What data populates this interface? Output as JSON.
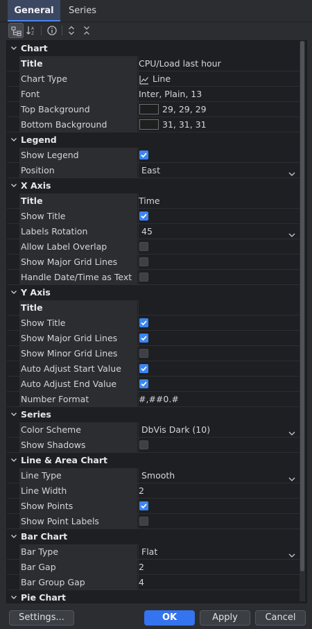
{
  "tabs": [
    "General",
    "Series"
  ],
  "sections": [
    {
      "title": "Chart",
      "rows": [
        {
          "label": "Title",
          "bold": true,
          "type": "text",
          "value": "CPU/Load last hour"
        },
        {
          "label": "Chart Type",
          "type": "charttype",
          "value": "Line",
          "icon": "line-chart-icon"
        },
        {
          "label": "Font",
          "type": "text",
          "value": "Inter, Plain, 13"
        },
        {
          "label": "Top Background",
          "type": "color",
          "value": "29, 29, 29",
          "color": "#1d1d1d"
        },
        {
          "label": "Bottom Background",
          "type": "color",
          "value": "31, 31, 31",
          "color": "#1f1f1f"
        }
      ]
    },
    {
      "title": "Legend",
      "rows": [
        {
          "label": "Show Legend",
          "type": "check",
          "checked": true
        },
        {
          "label": "Position",
          "type": "select",
          "value": "East"
        }
      ]
    },
    {
      "title": "X Axis",
      "rows": [
        {
          "label": "Title",
          "bold": true,
          "type": "text",
          "value": "Time"
        },
        {
          "label": "Show Title",
          "type": "check",
          "checked": true
        },
        {
          "label": "Labels Rotation",
          "type": "select",
          "value": "45"
        },
        {
          "label": "Allow Label Overlap",
          "type": "check",
          "checked": false
        },
        {
          "label": "Show Major Grid Lines",
          "type": "check",
          "checked": false
        },
        {
          "label": "Handle Date/Time as Text",
          "type": "check",
          "checked": false
        }
      ]
    },
    {
      "title": "Y Axis",
      "rows": [
        {
          "label": "Title",
          "bold": true,
          "type": "text",
          "value": ""
        },
        {
          "label": "Show Title",
          "type": "check",
          "checked": true
        },
        {
          "label": "Show Major Grid Lines",
          "type": "check",
          "checked": true
        },
        {
          "label": "Show Minor Grid Lines",
          "type": "check",
          "checked": false
        },
        {
          "label": "Auto Adjust Start Value",
          "type": "check",
          "checked": true
        },
        {
          "label": "Auto Adjust End Value",
          "type": "check",
          "checked": true
        },
        {
          "label": "Number Format",
          "type": "text",
          "value": "#,##0.#"
        }
      ]
    },
    {
      "title": "Series",
      "rows": [
        {
          "label": "Color Scheme",
          "type": "select",
          "value": "DbVis Dark (10)"
        },
        {
          "label": "Show Shadows",
          "type": "check",
          "checked": false
        }
      ]
    },
    {
      "title": "Line & Area Chart",
      "rows": [
        {
          "label": "Line Type",
          "type": "select",
          "value": "Smooth"
        },
        {
          "label": "Line Width",
          "type": "text",
          "value": "2"
        },
        {
          "label": "Show Points",
          "type": "check",
          "checked": true
        },
        {
          "label": "Show Point Labels",
          "type": "check",
          "checked": false
        }
      ]
    },
    {
      "title": "Bar Chart",
      "rows": [
        {
          "label": "Bar Type",
          "type": "select",
          "value": "Flat"
        },
        {
          "label": "Bar Gap",
          "type": "text",
          "value": "2"
        },
        {
          "label": "Bar Group Gap",
          "type": "text",
          "value": "4"
        }
      ]
    },
    {
      "title": "Pie Chart",
      "rows": []
    }
  ],
  "buttons": {
    "settings": "Settings...",
    "ok": "OK",
    "apply": "Apply",
    "cancel": "Cancel"
  },
  "colors": {
    "accent": "#3574f0",
    "checkbox_on": "#3d85f0",
    "tab_active_bg": "#3c4861"
  }
}
